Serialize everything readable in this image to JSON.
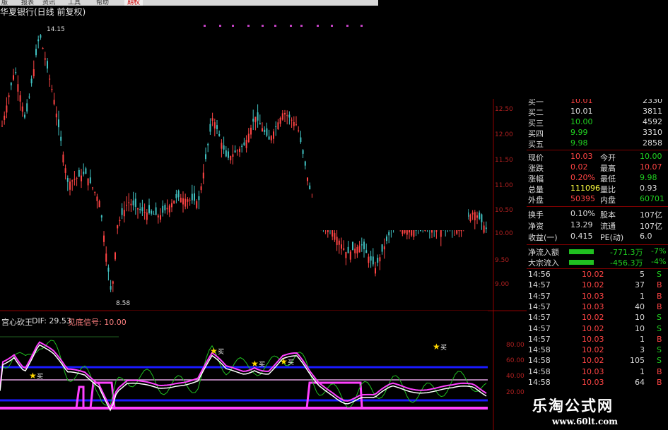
{
  "stock_title": "华夏银行(日线 前复权)",
  "high_label": "14.15",
  "low_label": "8.58",
  "price_axis": [
    "12.50",
    "12.00",
    "11.50",
    "11.00",
    "10.50",
    "10.00",
    "9.50",
    "9.00"
  ],
  "indicator": {
    "name": "宫心砍王",
    "dif_label": "DIF: 29.53",
    "signal_label": "见底信号: 10.00",
    "axis": [
      "80.00",
      "60.00",
      "40.00",
      "20.00"
    ],
    "buy_mark": "买"
  },
  "quote": {
    "bids": [
      {
        "label": "买二",
        "price": "10.01",
        "vol": "3811"
      },
      {
        "label": "买三",
        "price": "10.00",
        "vol": "4592"
      },
      {
        "label": "买四",
        "price": "9.99",
        "vol": "3310"
      },
      {
        "label": "买五",
        "price": "9.98",
        "vol": "2858"
      }
    ],
    "rows": [
      {
        "l1": "现价",
        "v1": "10.03",
        "l2": "今开",
        "v2": "10.00"
      },
      {
        "l1": "涨跌",
        "v1": "0.02",
        "l2": "最高",
        "v2": "10.07"
      },
      {
        "l1": "涨幅",
        "v1": "0.20%",
        "l2": "最低",
        "v2": "9.98"
      },
      {
        "l1": "总量",
        "v1": "111096",
        "l2": "量比",
        "v2": "0.93"
      },
      {
        "l1": "外盘",
        "v1": "50395",
        "l2": "内盘",
        "v2": "60701"
      }
    ],
    "stats": [
      {
        "l1": "换手",
        "v1": "0.10%",
        "l2": "股本",
        "v2": "107亿"
      },
      {
        "l1": "净资",
        "v1": "13.29",
        "l2": "流通",
        "v2": "107亿"
      },
      {
        "l1": "收益(一)",
        "v1": "0.415",
        "l2": "PE(动)",
        "v2": "6.0"
      }
    ],
    "flows": [
      {
        "label": "净流入额",
        "value": "-771.3万",
        "pct": "-7%",
        "fill": 0.7
      },
      {
        "label": "大宗流入",
        "value": "-456.3万",
        "pct": "-4%",
        "fill": 0.7
      }
    ],
    "ticks": [
      {
        "t": "14:56",
        "p": "10.02",
        "v": "5",
        "d": "S"
      },
      {
        "t": "14:57",
        "p": "10.02",
        "v": "37",
        "d": "B"
      },
      {
        "t": "14:57",
        "p": "10.03",
        "v": "1",
        "d": "B"
      },
      {
        "t": "14:57",
        "p": "10.03",
        "v": "40",
        "d": "B"
      },
      {
        "t": "14:57",
        "p": "10.02",
        "v": "10",
        "d": "S"
      },
      {
        "t": "14:57",
        "p": "10.02",
        "v": "10",
        "d": "S"
      },
      {
        "t": "14:57",
        "p": "10.03",
        "v": "1",
        "d": "B"
      },
      {
        "t": "14:58",
        "p": "10.02",
        "v": "3",
        "d": "S"
      },
      {
        "t": "14:58",
        "p": "10.02",
        "v": "105",
        "d": "S"
      },
      {
        "t": "14:58",
        "p": "10.03",
        "v": "1",
        "d": "B"
      },
      {
        "t": "14:58",
        "p": "10.03",
        "v": "64",
        "d": "B"
      }
    ]
  },
  "watermark": {
    "cn": "乐淘公式网",
    "url": "www.60lt.com"
  },
  "colors": {
    "up": "#ff4444",
    "down": "#40c0c0",
    "magenta": "#ff40ff",
    "blue": "#1a1aff",
    "green": "#20c020",
    "white": "#ffffff"
  }
}
